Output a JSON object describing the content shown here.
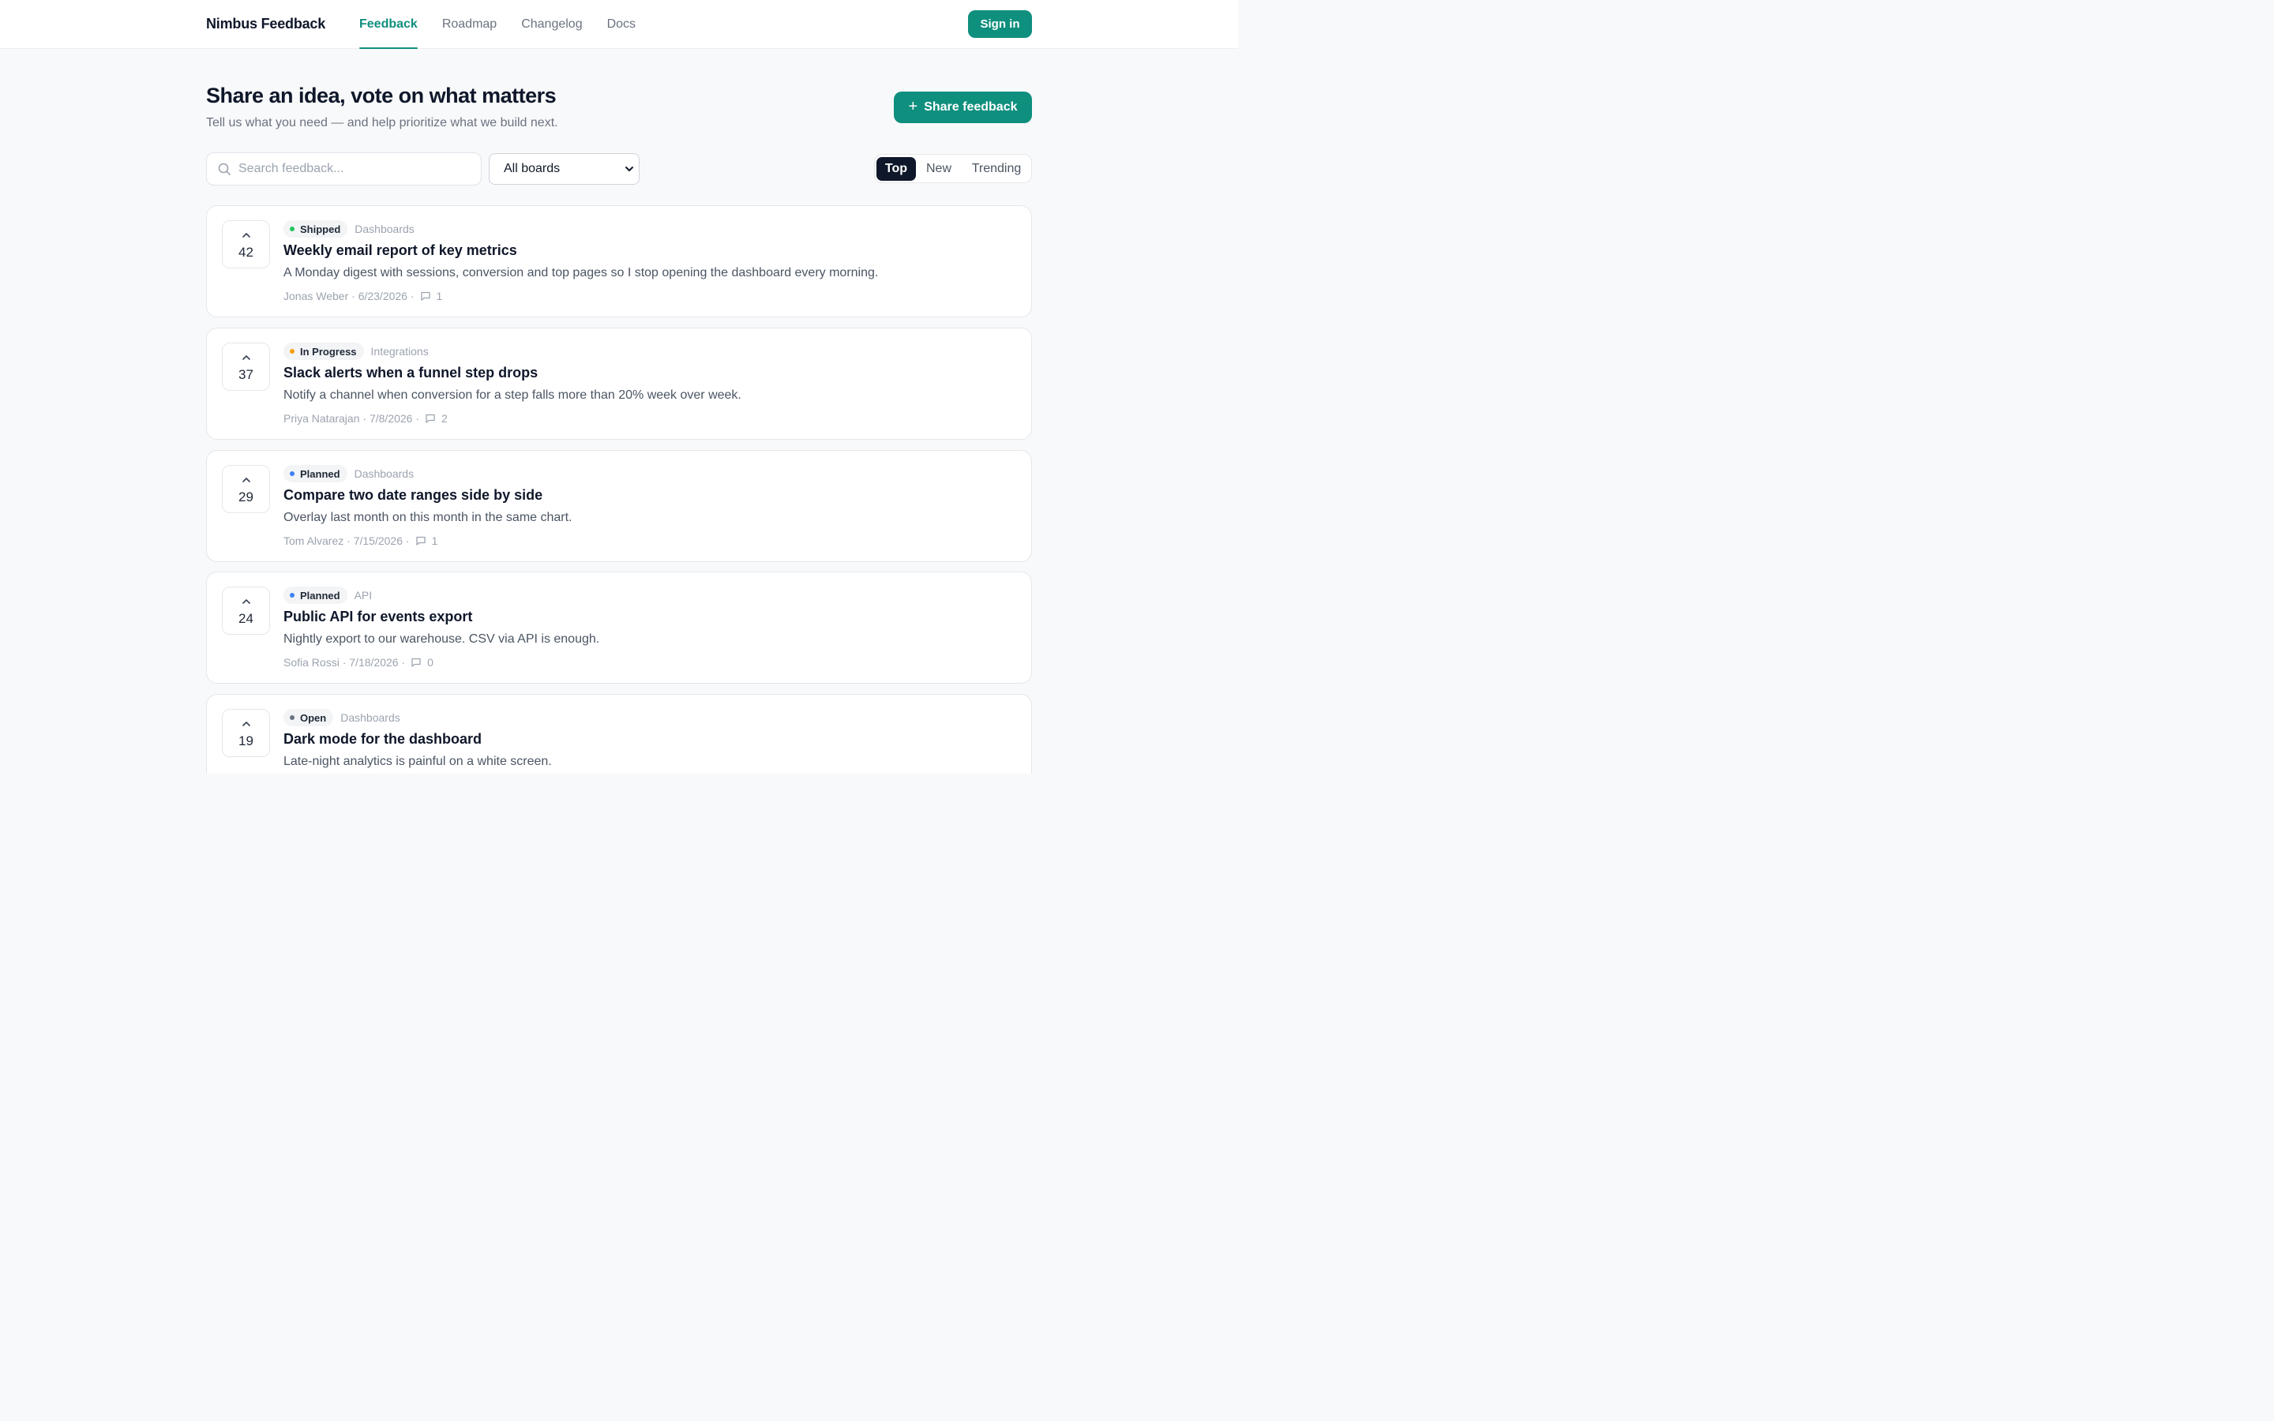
{
  "header": {
    "brand": "Nimbus Feedback",
    "nav": [
      {
        "label": "Feedback",
        "active": true
      },
      {
        "label": "Roadmap",
        "active": false
      },
      {
        "label": "Changelog",
        "active": false
      },
      {
        "label": "Docs",
        "active": false
      }
    ],
    "signin_label": "Sign in"
  },
  "hero": {
    "title": "Share an idea, vote on what matters",
    "subtitle": "Tell us what you need — and help prioritize what we build next.",
    "share_label": "Share feedback"
  },
  "filters": {
    "search_placeholder": "Search feedback...",
    "search_value": "",
    "board_selected": "All boards",
    "sort_options": [
      "Top",
      "New",
      "Trending"
    ],
    "sort_active": "Top"
  },
  "colors": {
    "accent": "#0f8f7e",
    "status_shipped": "#22c55e",
    "status_in_progress": "#f59e0b",
    "status_planned": "#3b82f6",
    "status_open": "#6b7280"
  },
  "items": [
    {
      "votes": "42",
      "status": "Shipped",
      "board": "Dashboards",
      "title": "Weekly email report of key metrics",
      "description": "A Monday digest with sessions, conversion and top pages so I stop opening the dashboard every morning.",
      "author": "Jonas Weber",
      "date": "6/23/2026",
      "comments": "1"
    },
    {
      "votes": "37",
      "status": "In Progress",
      "board": "Integrations",
      "title": "Slack alerts when a funnel step drops",
      "description": "Notify a channel when conversion for a step falls more than 20% week over week.",
      "author": "Priya Natarajan",
      "date": "7/8/2026",
      "comments": "2"
    },
    {
      "votes": "29",
      "status": "Planned",
      "board": "Dashboards",
      "title": "Compare two date ranges side by side",
      "description": "Overlay last month on this month in the same chart.",
      "author": "Tom Alvarez",
      "date": "7/15/2026",
      "comments": "1"
    },
    {
      "votes": "24",
      "status": "Planned",
      "board": "API",
      "title": "Public API for events export",
      "description": "Nightly export to our warehouse. CSV via API is enough.",
      "author": "Sofia Rossi",
      "date": "7/18/2026",
      "comments": "0"
    },
    {
      "votes": "19",
      "status": "Open",
      "board": "Dashboards",
      "title": "Dark mode for the dashboard",
      "description": "Late-night analytics is painful on a white screen.",
      "author": "",
      "date": "",
      "comments": ""
    }
  ]
}
